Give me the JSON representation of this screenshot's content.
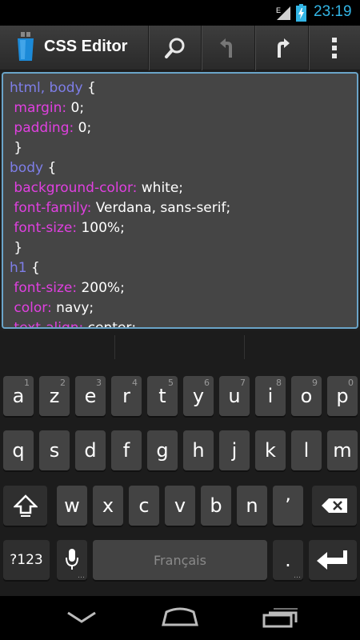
{
  "status_bar": {
    "time": "23:19",
    "network": "E"
  },
  "action_bar": {
    "title": "CSS Editor",
    "icons": [
      "app-icon",
      "search-icon",
      "undo-icon",
      "redo-icon",
      "overflow-menu-icon"
    ]
  },
  "editor": {
    "lines": [
      [
        {
          "t": "sel",
          "v": "html, body"
        },
        {
          "t": "pun",
          "v": " {"
        }
      ],
      [
        {
          "t": "prop",
          "v": " margin:"
        },
        {
          "t": "val",
          "v": " 0;"
        }
      ],
      [
        {
          "t": "prop",
          "v": " padding:"
        },
        {
          "t": "val",
          "v": " 0;"
        }
      ],
      [
        {
          "t": "pun",
          "v": " }"
        }
      ],
      [
        {
          "t": "sel",
          "v": "body"
        },
        {
          "t": "pun",
          "v": " {"
        }
      ],
      [
        {
          "t": "prop",
          "v": " background-color:"
        },
        {
          "t": "val",
          "v": " white;"
        }
      ],
      [
        {
          "t": "prop",
          "v": " font-family:"
        },
        {
          "t": "val",
          "v": " Verdana, sans-serif;"
        }
      ],
      [
        {
          "t": "prop",
          "v": " font-size:"
        },
        {
          "t": "val",
          "v": " 100%;"
        }
      ],
      [
        {
          "t": "pun",
          "v": " }"
        }
      ],
      [
        {
          "t": "sel",
          "v": "h1"
        },
        {
          "t": "pun",
          "v": " {"
        }
      ],
      [
        {
          "t": "prop",
          "v": " font-size:"
        },
        {
          "t": "val",
          "v": " 200%;"
        }
      ],
      [
        {
          "t": "prop",
          "v": " color:"
        },
        {
          "t": "val",
          "v": " navy;"
        }
      ],
      [
        {
          "t": "prop",
          "v": " text-align:"
        },
        {
          "t": "val",
          "v": " center;"
        }
      ]
    ]
  },
  "keyboard": {
    "row1": [
      {
        "k": "a",
        "h": "1"
      },
      {
        "k": "z",
        "h": "2"
      },
      {
        "k": "e",
        "h": "3"
      },
      {
        "k": "r",
        "h": "4"
      },
      {
        "k": "t",
        "h": "5"
      },
      {
        "k": "y",
        "h": "6"
      },
      {
        "k": "u",
        "h": "7"
      },
      {
        "k": "i",
        "h": "8"
      },
      {
        "k": "o",
        "h": "9"
      },
      {
        "k": "p",
        "h": "0"
      }
    ],
    "row2": [
      "q",
      "s",
      "d",
      "f",
      "g",
      "h",
      "j",
      "k",
      "l",
      "m"
    ],
    "row3": [
      "w",
      "x",
      "c",
      "v",
      "b",
      "n",
      "’"
    ],
    "symbols_label": "?123",
    "space_label": "Français",
    "period_label": "."
  },
  "colors": {
    "selector": "#7e7ee8",
    "property": "#e040e0",
    "value": "#ffffff",
    "editor_border": "#6aa4c8",
    "time": "#33b5e5"
  }
}
